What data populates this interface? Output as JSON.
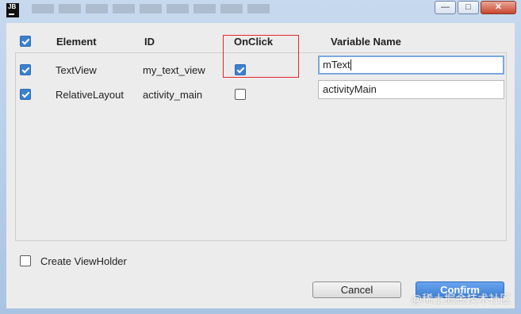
{
  "window": {
    "app_icon_text": "JB",
    "controls": {
      "minimize": "—",
      "maximize": "□",
      "close": "✕"
    }
  },
  "header": {
    "element": "Element",
    "id": "ID",
    "onclick": "OnClick",
    "variable_name": "Variable Name"
  },
  "rows": [
    {
      "element": "TextView",
      "id": "my_text_view",
      "variable_name": "mText"
    },
    {
      "element": "RelativeLayout",
      "id": "activity_main",
      "variable_name": "activityMain"
    }
  ],
  "create_viewholder_label": "Create ViewHolder",
  "buttons": {
    "cancel": "Cancel",
    "confirm": "Confirm"
  },
  "watermark": "@稀土掘金技术社区",
  "colors": {
    "accent": "#3b81d0",
    "highlight": "#e3262d"
  }
}
